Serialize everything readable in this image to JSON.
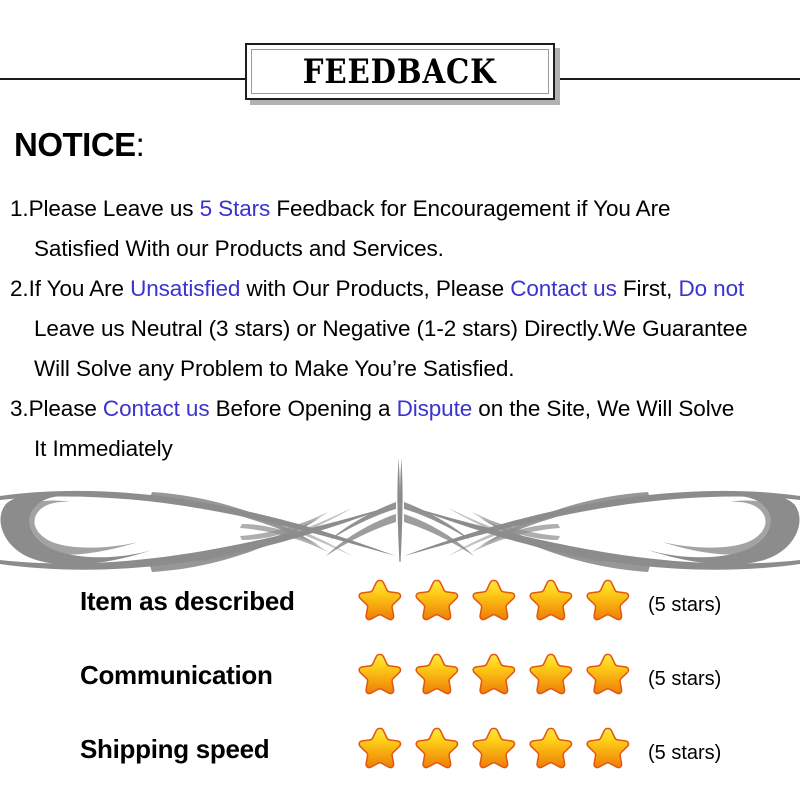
{
  "banner": {
    "title": "FEEDBACK"
  },
  "notice": {
    "heading": "NOTICE",
    "heading_colon": ":",
    "lines": [
      {
        "id": "notice-line-1a",
        "indent": false,
        "segments": [
          {
            "text": "1.Please Leave us  ",
            "color": "black"
          },
          {
            "text": "5 Stars",
            "color": "blue"
          },
          {
            "text": "  Feedback for  Encouragement  if You Are",
            "color": "black"
          }
        ]
      },
      {
        "id": "notice-line-1b",
        "indent": true,
        "segments": [
          {
            "text": "Satisfied With our Products and Services.",
            "color": "black"
          }
        ]
      },
      {
        "id": "notice-line-2a",
        "indent": false,
        "segments": [
          {
            "text": "2.If You Are ",
            "color": "black"
          },
          {
            "text": "Unsatisfied",
            "color": "blue"
          },
          {
            "text": " with Our Products, Please ",
            "color": "black"
          },
          {
            "text": "Contact us",
            "color": "blue"
          },
          {
            "text": " First, ",
            "color": "black"
          },
          {
            "text": "Do not",
            "color": "blue"
          }
        ]
      },
      {
        "id": "notice-line-2b",
        "indent": true,
        "segments": [
          {
            "text": "Leave us Neutral (3 stars) or Negative (1-2 stars) Directly.We Guarantee",
            "color": "black"
          }
        ]
      },
      {
        "id": "notice-line-2c",
        "indent": true,
        "segments": [
          {
            "text": "Will Solve any Problem to Make You’re  Satisfied.",
            "color": "black"
          }
        ]
      },
      {
        "id": "notice-line-3a",
        "indent": false,
        "segments": [
          {
            "text": "3.Please ",
            "color": "black"
          },
          {
            "text": "Contact us",
            "color": "blue"
          },
          {
            "text": " Before Opening a ",
            "color": "black"
          },
          {
            "text": "Dispute",
            "color": "blue"
          },
          {
            "text": " on the Site, We Will Solve",
            "color": "black"
          }
        ]
      },
      {
        "id": "notice-line-3b",
        "indent": true,
        "segments": [
          {
            "text": "It Immediately",
            "color": "black"
          }
        ]
      }
    ]
  },
  "ornament": {
    "icon": "flourish-divider-icon",
    "color": "#8c8c8c"
  },
  "ratings": [
    {
      "label": "Item as described",
      "stars": 5,
      "count_label": "(5 stars)"
    },
    {
      "label": "Communication",
      "stars": 5,
      "count_label": "(5 stars)"
    },
    {
      "label": "Shipping speed",
      "stars": 5,
      "count_label": "(5 stars)"
    }
  ],
  "colors": {
    "highlight_blue": "#3b32cf",
    "star_top": "#ffdd22",
    "star_bottom": "#ef8a0c",
    "star_outline": "#e2500f",
    "text_black": "#000000",
    "ornament_gray": "#8c8c8c"
  }
}
